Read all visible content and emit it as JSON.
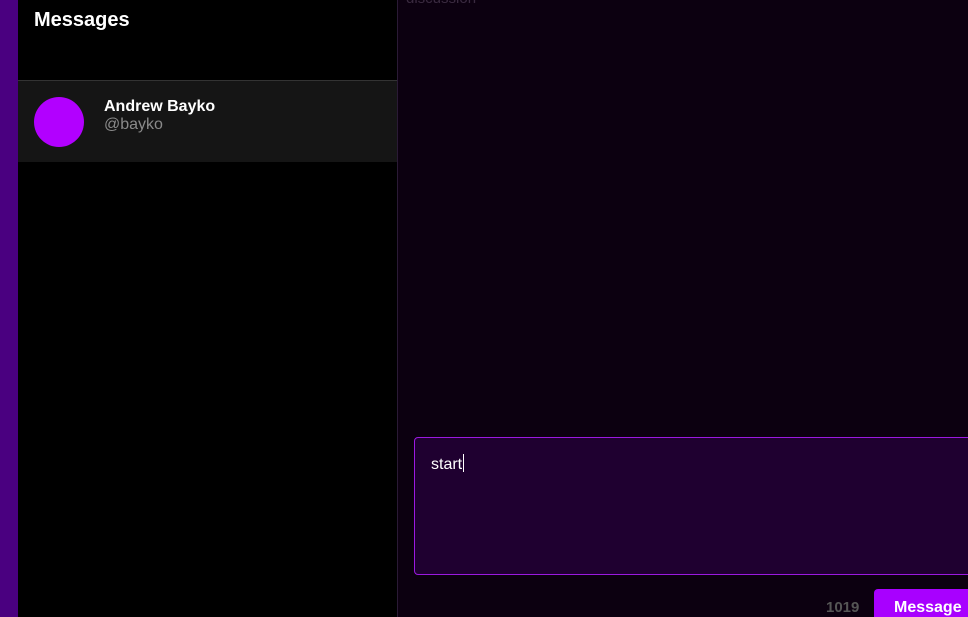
{
  "sidebar": {
    "title": "Messages",
    "conversations": [
      {
        "name": "Andrew Bayko",
        "handle": "@bayko"
      }
    ]
  },
  "chat": {
    "cut_off_text": "discussion",
    "composer": {
      "value": "start"
    },
    "char_count": "1019",
    "send_label": "Message"
  },
  "colors": {
    "accent": "#a800ff",
    "rail": "#4a0080",
    "chat_background": "#0c0010",
    "composer_background": "#1f0030"
  }
}
